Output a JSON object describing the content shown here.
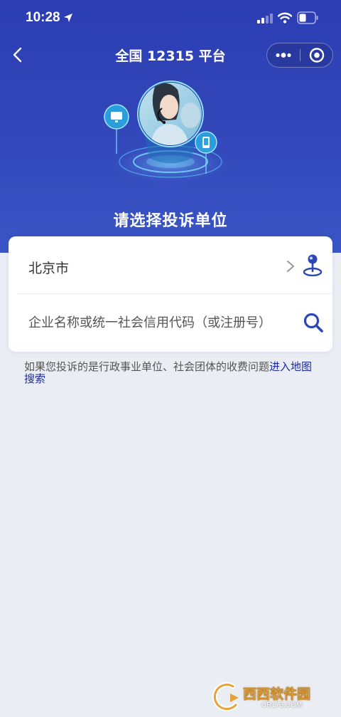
{
  "status_bar": {
    "time": "10:28"
  },
  "nav": {
    "title": "全国 12315 平台"
  },
  "hero": {
    "heading": "请选择投诉单位"
  },
  "card": {
    "region_value": "北京市",
    "search_placeholder": "企业名称或统一社会信用代码（或注册号）"
  },
  "note": {
    "text": "如果您投诉的是行政事业单位、社会团体的收费问题",
    "link": "进入地图搜索"
  },
  "watermark": {
    "main": "西西软件园",
    "sub": "CR173.COM"
  },
  "colors": {
    "hero_top": "#2c3db4",
    "hero_bottom": "#3a55c5",
    "page_bg": "#eaedf3",
    "accent": "#2c47b8",
    "link": "#1d2a9e"
  },
  "icons": [
    "location-arrow-icon",
    "signal-icon",
    "wifi-icon",
    "battery-icon",
    "back-icon",
    "more-icon",
    "close-circle-icon",
    "chevron-right-icon",
    "map-pin-icon",
    "search-icon"
  ]
}
